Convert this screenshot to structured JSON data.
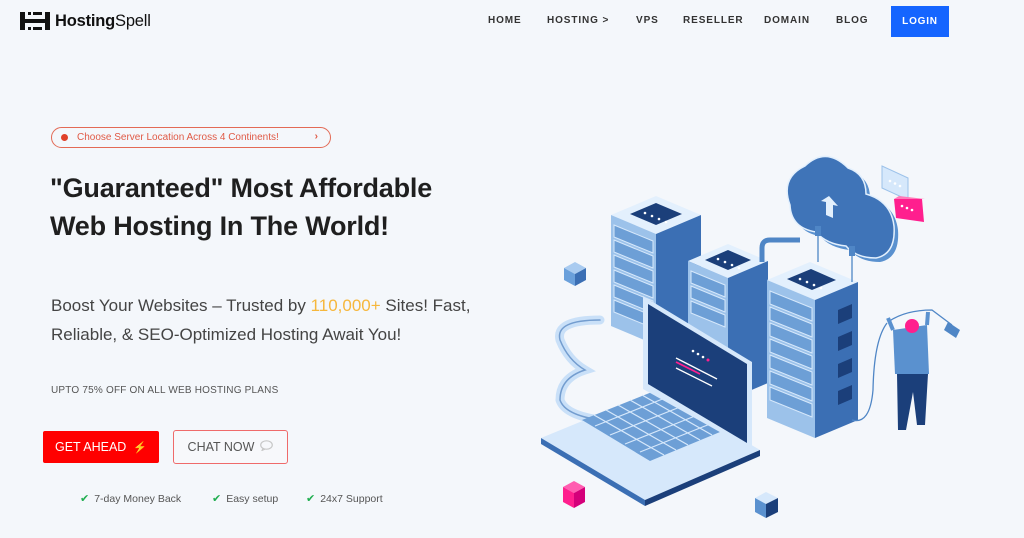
{
  "header": {
    "logo": {
      "bold": "Hosting",
      "regular": "Spell",
      "icon": "hosting-spell-logo-icon"
    },
    "nav": [
      {
        "label": "HOME"
      },
      {
        "label": "HOSTING >"
      },
      {
        "label": "VPS"
      },
      {
        "label": "RESELLER"
      },
      {
        "label": "DOMAIN"
      },
      {
        "label": "BLOG"
      }
    ],
    "login_label": "LOGIN"
  },
  "hero": {
    "pill": {
      "text": "Choose Server Location Across 4 Continents!",
      "chevron": "›",
      "icon": "red-dot-icon"
    },
    "headline": "\"Guaranteed\" Most Affordable Web Hosting In The World!",
    "sub_before": "Boost Your Websites – Trusted by ",
    "sub_highlight": "110,000+",
    "sub_after": " Sites! Fast, Reliable, & SEO-Optimized Hosting Await You!",
    "offer": "UPTO 75% OFF ON ALL WEB HOSTING PLANS",
    "primary_button": {
      "label": "GET AHEAD",
      "icon": "⚡"
    },
    "secondary_button": {
      "label": "CHAT NOW",
      "icon": "💬"
    },
    "features": [
      {
        "label": "7-day Money Back"
      },
      {
        "label": "Easy setup"
      },
      {
        "label": "24x7 Support"
      }
    ]
  },
  "colors": {
    "background": "#f4f7fb",
    "login": "#1565ff",
    "primary_button": "#ff0000",
    "secondary_border": "#ef6a6a",
    "highlight": "#f6b73c",
    "pill": "#e05a46",
    "check": "#1fae4f",
    "illustration_dark": "#1b3f7a",
    "illustration_mid": "#4f86c6",
    "illustration_light": "#d6e8fb",
    "illustration_accent": "#ff1f8e"
  },
  "illustration": {
    "alt": "Isometric servers, cloud, laptop and technician illustration"
  }
}
